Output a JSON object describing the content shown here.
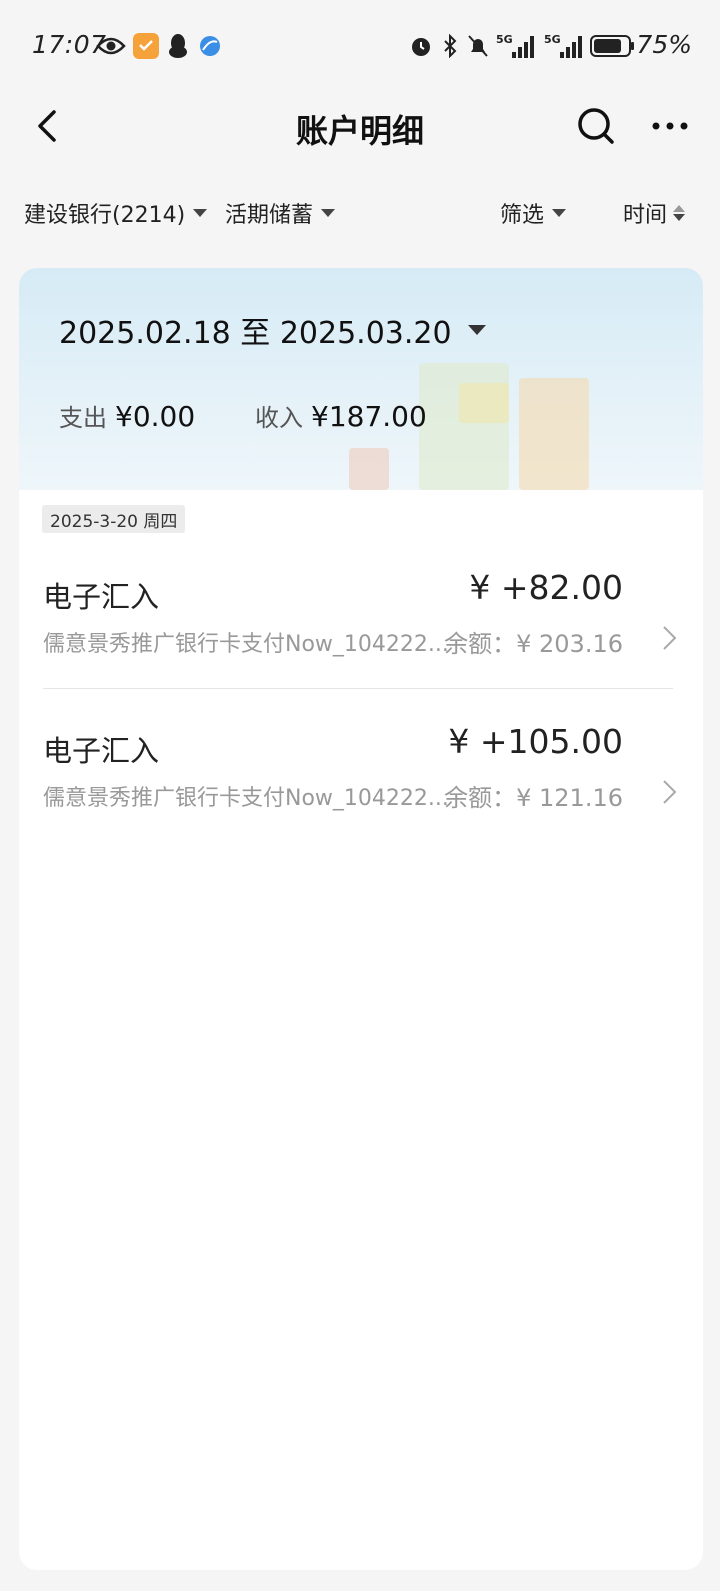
{
  "status_bar": {
    "time": "17:07",
    "battery": "75%",
    "icons_left": [
      "eye-icon",
      "app-badge-icon",
      "qq-penguin-icon",
      "browser-icon"
    ],
    "icons_right": [
      "alarm-icon",
      "bluetooth-icon",
      "mute-icon",
      "signal-5g-icon",
      "signal-5g-icon",
      "battery-icon"
    ],
    "signal_label": "5G"
  },
  "nav": {
    "title": "账户明细",
    "back_icon": "back-arrow-icon",
    "search_icon": "search-icon",
    "more_icon": "more-icon"
  },
  "filters": {
    "account": "建设银行(2214)",
    "account_type": "活期储蓄",
    "filter": "筛选",
    "sort": "时间"
  },
  "summary": {
    "date_range": "2025.02.18 至 2025.03.20",
    "expense_label": "支出",
    "expense_value": "¥0.00",
    "income_label": "收入",
    "income_value": "¥187.00"
  },
  "day_group": {
    "date": "2025-3-20 周四"
  },
  "transactions": [
    {
      "title": "电子汇入",
      "amount": "¥ +82.00",
      "description": "儒意景秀推广银行卡支付Now_104222...",
      "balance": "余额：¥ 203.16"
    },
    {
      "title": "电子汇入",
      "amount": "¥ +105.00",
      "description": "儒意景秀推广银行卡支付Now_104222...",
      "balance": "余额：¥ 121.16"
    }
  ],
  "colors": {
    "background": "#f5f5f6",
    "card": "#ffffff",
    "muted_text": "#999999",
    "banner": "#d6ebf6",
    "badge": "#f5a23a"
  }
}
